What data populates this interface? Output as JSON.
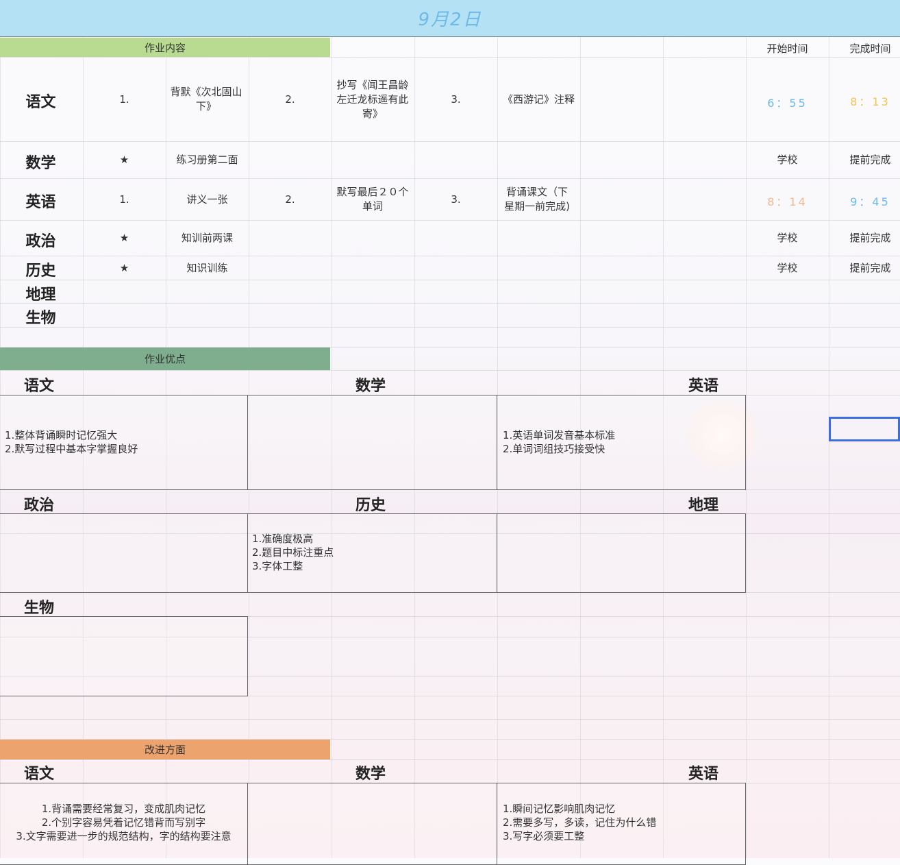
{
  "title": "9月2日",
  "sections": {
    "homework": "作业内容",
    "strengths": "作业优点",
    "improvements": "改进方面"
  },
  "columns": {
    "start": "开始时间",
    "finish": "完成时间"
  },
  "subjects": [
    "语文",
    "数学",
    "英语",
    "政治",
    "历史",
    "地理",
    "生物"
  ],
  "homework_rows": {
    "chinese": {
      "n1": "1.",
      "t1": "背默《次北固山下》",
      "n2": "2.",
      "t2": "抄写《闻王昌龄左迁龙标遥有此寄》",
      "n3": "3.",
      "t3": "《西游记》注释",
      "start": "6：55",
      "finish": "8：13"
    },
    "math": {
      "mark": "★",
      "t1": "练习册第二面",
      "start": "学校",
      "finish": "提前完成"
    },
    "english": {
      "n1": "1.",
      "t1": "讲义一张",
      "n2": "2.",
      "t2": "默写最后２０个单词",
      "n3": "3.",
      "t3": "背诵课文（下星期一前完成)",
      "start": "8：14",
      "finish": "9：45"
    },
    "politics": {
      "mark": "★",
      "t1": "知训前两课",
      "start": "学校",
      "finish": "提前完成"
    },
    "history": {
      "mark": "★",
      "t1": "知识训练",
      "start": "学校",
      "finish": "提前完成"
    }
  },
  "strengths": {
    "chinese": "1.整体背诵瞬时记忆强大\n2.默写过程中基本字掌握良好",
    "english": "1.英语单词发音基本标准\n2.单词词组技巧接受快",
    "history": "1.准确度极高\n2.题目中标注重点\n3.字体工整"
  },
  "improvements": {
    "chinese": "1.背诵需要经常复习，变成肌肉记忆\n2.个别字容易凭着记忆错背而写别字\n3.文字需要进一步的规范结构，字的结构要注意",
    "english": "1.瞬间记忆影响肌肉记忆\n2.需要多写，多读，记住为什么错\n3.写字必须要工整"
  },
  "colors": {
    "title_bg": "#b4e1f4",
    "title_text": "#6cb9ea",
    "homework_bar": "#b8da91",
    "strengths_bar": "#7eae8d",
    "improvements_bar": "#eda36e",
    "time_blue": "#6cb9ea",
    "time_yellow": "#f2c355",
    "time_orange": "#f2b98f",
    "selection": "#3b6fe0"
  }
}
